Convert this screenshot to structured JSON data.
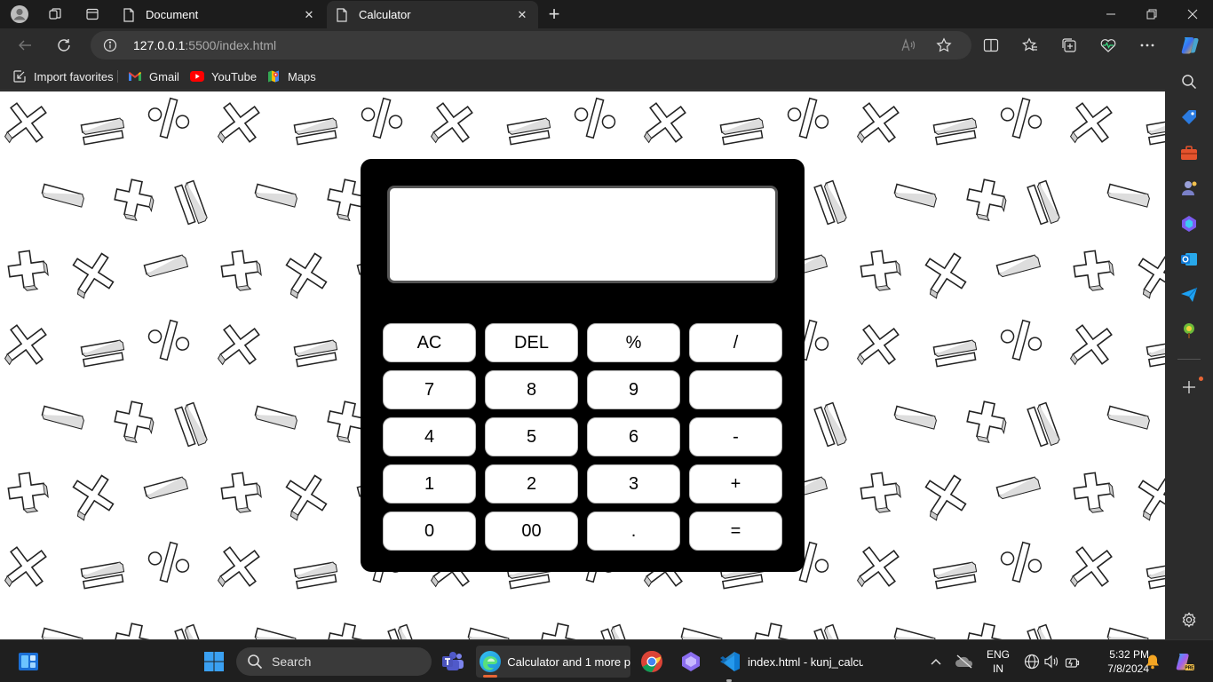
{
  "browser": {
    "tabs": [
      {
        "title": "Document"
      },
      {
        "title": "Calculator"
      }
    ],
    "address": {
      "host": "127.0.0.1",
      "path": ":5500/index.html"
    },
    "favorites": [
      {
        "label": "Import favorites",
        "icon": "import-icon"
      },
      {
        "label": "Gmail",
        "icon": "gmail-icon"
      },
      {
        "label": "YouTube",
        "icon": "youtube-icon"
      },
      {
        "label": "Maps",
        "icon": "maps-icon"
      }
    ]
  },
  "calculator": {
    "display_value": "",
    "keys": [
      "AC",
      "DEL",
      "%",
      "/",
      "7",
      "8",
      "9",
      "",
      "4",
      "5",
      "6",
      "-",
      "1",
      "2",
      "3",
      "+",
      "0",
      "00",
      ".",
      "="
    ]
  },
  "taskbar": {
    "search_placeholder": "Search",
    "edge_app_label": "Calculator and 1 more p",
    "vscode_app_label": "index.html - kunj_calcul",
    "language": {
      "line1": "ENG",
      "line2": "IN"
    },
    "clock": {
      "time": "5:32 PM",
      "date": "7/8/2024"
    }
  },
  "colors": {
    "accent": "#e86535",
    "calc_body": "#000000",
    "browser_bg": "#2c2c2c"
  }
}
